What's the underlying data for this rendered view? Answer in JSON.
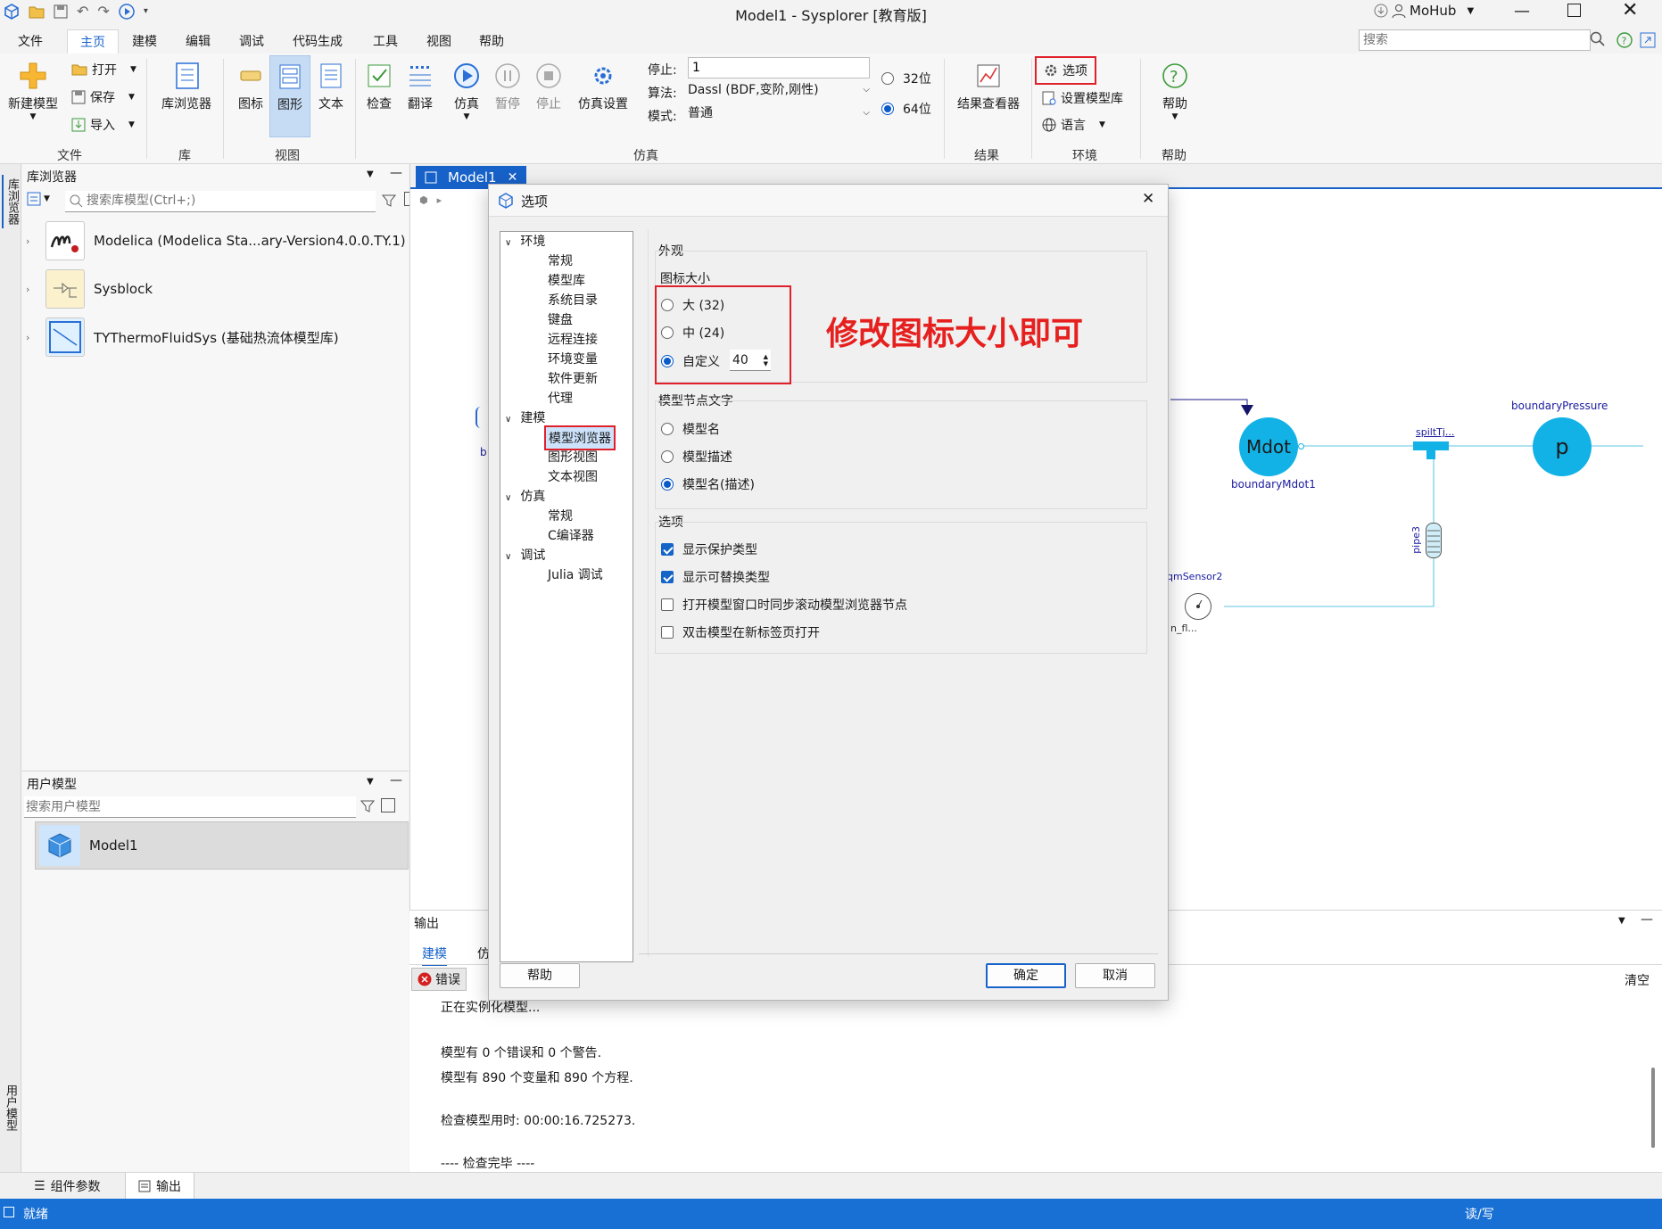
{
  "window": {
    "title": "Model1 - Sysplorer [教育版]",
    "user": "MoHub"
  },
  "menu": [
    "文件",
    "主页",
    "建模",
    "编辑",
    "调试",
    "代码生成",
    "工具",
    "视图",
    "帮助"
  ],
  "search": {
    "placeholder": "搜索"
  },
  "ribbon": {
    "new_model": "新建模型",
    "open": "打开",
    "save": "保存",
    "import": "导入",
    "group_file": "文件",
    "lib_browser": "库浏览器",
    "group_lib": "库",
    "icon": "图标",
    "diagram": "图形",
    "text": "文本",
    "group_view": "视图",
    "check": "检查",
    "translate": "翻译",
    "simulate": "仿真",
    "pause": "暂停",
    "stop": "停止",
    "sim_settings": "仿真设置",
    "stop_label": "停止:",
    "stop_value": "1",
    "algo_label": "算法:",
    "algo_value": "Dassl (BDF,变阶,刚性)",
    "mode_label": "模式:",
    "mode_value": "普通",
    "bit32": "32位",
    "bit64": "64位",
    "group_sim": "仿真",
    "result_viewer": "结果查看器",
    "group_result": "结果",
    "options": "选项",
    "set_lib": "设置模型库",
    "language": "语言",
    "group_env": "环境",
    "help": "帮助",
    "group_help": "帮助"
  },
  "lib_panel": {
    "title": "库浏览器",
    "search_placeholder": "搜索库模型(Ctrl+;)",
    "items": [
      "Modelica (Modelica Sta...ary-Version4.0.0.TY.1)",
      "Sysblock",
      "TYThermoFluidSys (基础热流体模型库)"
    ]
  },
  "side_tabs": {
    "top": "库浏览器",
    "bottom": "用户模型"
  },
  "user_panel": {
    "title": "用户模型",
    "search_placeholder": "搜索用户模型",
    "items": [
      "Model1"
    ]
  },
  "doc_tab": "Model1",
  "canvas": {
    "mdot": "Mdot",
    "mdot_label": "boundaryMdot1",
    "p": "p",
    "p_label": "boundaryPressure",
    "split": "spiltTj...",
    "pipe": "pipe3",
    "sensor": "qmSensor2",
    "sensor_sub": "n_fl...",
    "left_frag": "b"
  },
  "output": {
    "title": "输出",
    "tabs": [
      "建模",
      "仿"
    ],
    "error_btn": "错误",
    "clear": "清空",
    "lines": [
      "正在实例化模型...",
      "模型有 0 个错误和 0 个警告.",
      "模型有 890 个变量和 890 个方程.",
      "检查模型用时: 00:00:16.725273.",
      "---- 检查完毕 ----"
    ]
  },
  "bottom_tabs": [
    "组件参数",
    "输出"
  ],
  "status": {
    "left": "就绪",
    "right": "读/写"
  },
  "dialog": {
    "title": "选项",
    "tree": [
      {
        "label": "环境",
        "children": [
          "常规",
          "模型库",
          "系统目录",
          "键盘",
          "远程连接",
          "环境变量",
          "软件更新",
          "代理"
        ]
      },
      {
        "label": "建模",
        "children": [
          "模型浏览器",
          "图形视图",
          "文本视图"
        ]
      },
      {
        "label": "仿真",
        "children": [
          "常规",
          "C编译器"
        ]
      },
      {
        "label": "调试",
        "children": [
          "Julia 调试"
        ]
      }
    ],
    "appearance": "外观",
    "icon_size": "图标大小",
    "size_large": "大 (32)",
    "size_medium": "中 (24)",
    "size_custom": "自定义",
    "custom_value": "40",
    "annotation": "修改图标大小即可",
    "node_text": "模型节点文字",
    "node_name": "模型名",
    "node_desc": "模型描述",
    "node_both": "模型名(描述)",
    "options": "选项",
    "opt1": "显示保护类型",
    "opt2": "显示可替换类型",
    "opt3": "打开模型窗口时同步滚动模型浏览器节点",
    "opt4": "双击模型在新标签页打开",
    "help": "帮助",
    "ok": "确定",
    "cancel": "取消"
  }
}
